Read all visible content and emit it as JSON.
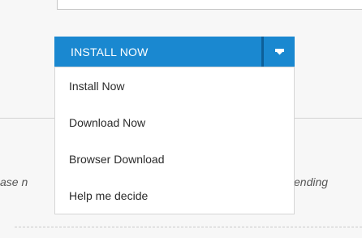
{
  "split_button": {
    "label": "INSTALL NOW",
    "toggle_icon": "caret-down-icon"
  },
  "menu": {
    "items": [
      {
        "label": "Install Now"
      },
      {
        "label": "Download Now"
      },
      {
        "label": "Browser Download"
      },
      {
        "label": "Help me decide"
      }
    ]
  },
  "notice": {
    "left_fragment": "ase n",
    "right_fragment": "ending"
  },
  "colors": {
    "button_blue": "#1a88d0",
    "button_separator": "#0d5f99",
    "page_background": "#f7f7f7"
  }
}
